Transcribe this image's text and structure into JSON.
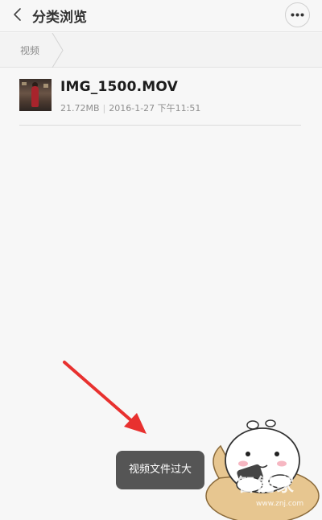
{
  "header": {
    "title": "分类浏览",
    "back_icon": "chevron-left-icon",
    "more_icon": "more-dots-icon"
  },
  "breadcrumb": {
    "items": [
      {
        "label": "视频"
      }
    ]
  },
  "files": [
    {
      "name": "IMG_1500.MOV",
      "size": "21.72MB",
      "date": "2016-1-27 下午11:51"
    }
  ],
  "toast": {
    "message": "视频文件过大"
  },
  "annotation": {
    "arrow_color": "#e8312f"
  },
  "watermark": {
    "text": "智能家",
    "url": "www.znj.com"
  }
}
